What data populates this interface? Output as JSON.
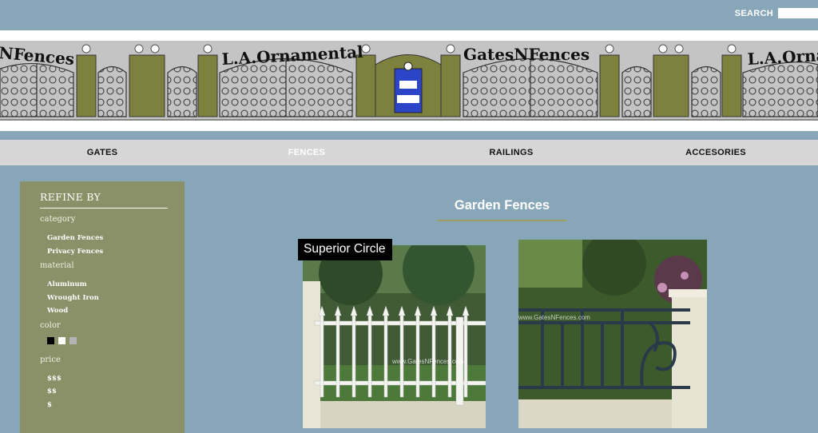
{
  "header": {
    "search_label": "SEARCH",
    "search_value": ""
  },
  "banner": {
    "logo_text_1": "L.A.Ornamental",
    "logo_text_2": "GatesNFences",
    "logo_text_3": "NFences",
    "logo_text_4": "L.A.Orna"
  },
  "nav": {
    "items": [
      {
        "label": "GATES"
      },
      {
        "label": "FENCES"
      },
      {
        "label": "RAILINGS"
      },
      {
        "label": "ACCESORIES"
      }
    ]
  },
  "sidebar": {
    "title": "REFINE BY",
    "category_label": "category",
    "categories": [
      "Garden Fences",
      "Privacy Fences"
    ],
    "material_label": "material",
    "materials": [
      "Aluminum",
      "Wrought Iron",
      "Wood"
    ],
    "color_label": "color",
    "colors": [
      "#000000",
      "#ffffff",
      "#b4b4b4"
    ],
    "price_label": "price",
    "prices": [
      "$$$",
      "$$",
      "$"
    ]
  },
  "main": {
    "heading": "Garden Fences",
    "products": [
      {
        "caption": "Superior Circle",
        "watermark": "www.GatesNFences.com"
      },
      {
        "caption": "",
        "watermark": "www.GatesNFences.com"
      }
    ]
  }
}
